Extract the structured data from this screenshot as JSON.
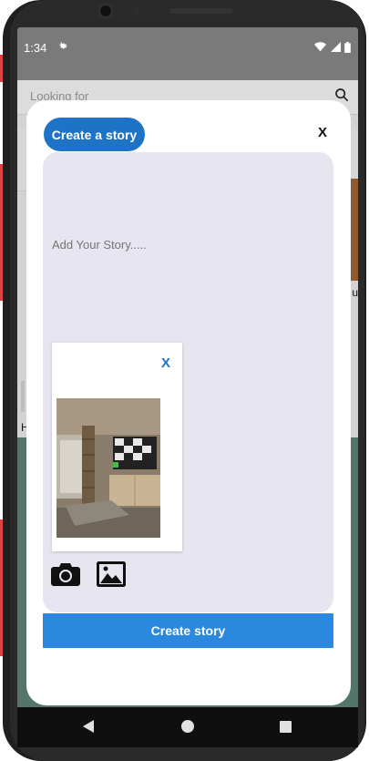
{
  "status_bar": {
    "time": "1:34",
    "settings_icon": "gear-icon",
    "icons": [
      "wifi-icon",
      "signal-icon",
      "battery-icon"
    ]
  },
  "background_app": {
    "search_placeholder": "Looking for",
    "search_icon": "search-icon",
    "card_label": "u",
    "side_label": "H"
  },
  "modal": {
    "badge_label": "Create a story",
    "close_label": "X",
    "story_placeholder": "Add Your Story.....",
    "preview_close_label": "X",
    "preview_image": "room-photo",
    "camera_icon": "camera-icon",
    "gallery_icon": "image-icon",
    "submit_label": "Create story"
  },
  "navigation": {
    "items": [
      "back-icon",
      "home-icon",
      "recents-icon"
    ]
  },
  "colors": {
    "accent": "#1e73c7",
    "button": "#2a88df",
    "story_area": "#e7e5ef",
    "status_bar": "#7a7a7a",
    "teal_background": "#54756c"
  }
}
